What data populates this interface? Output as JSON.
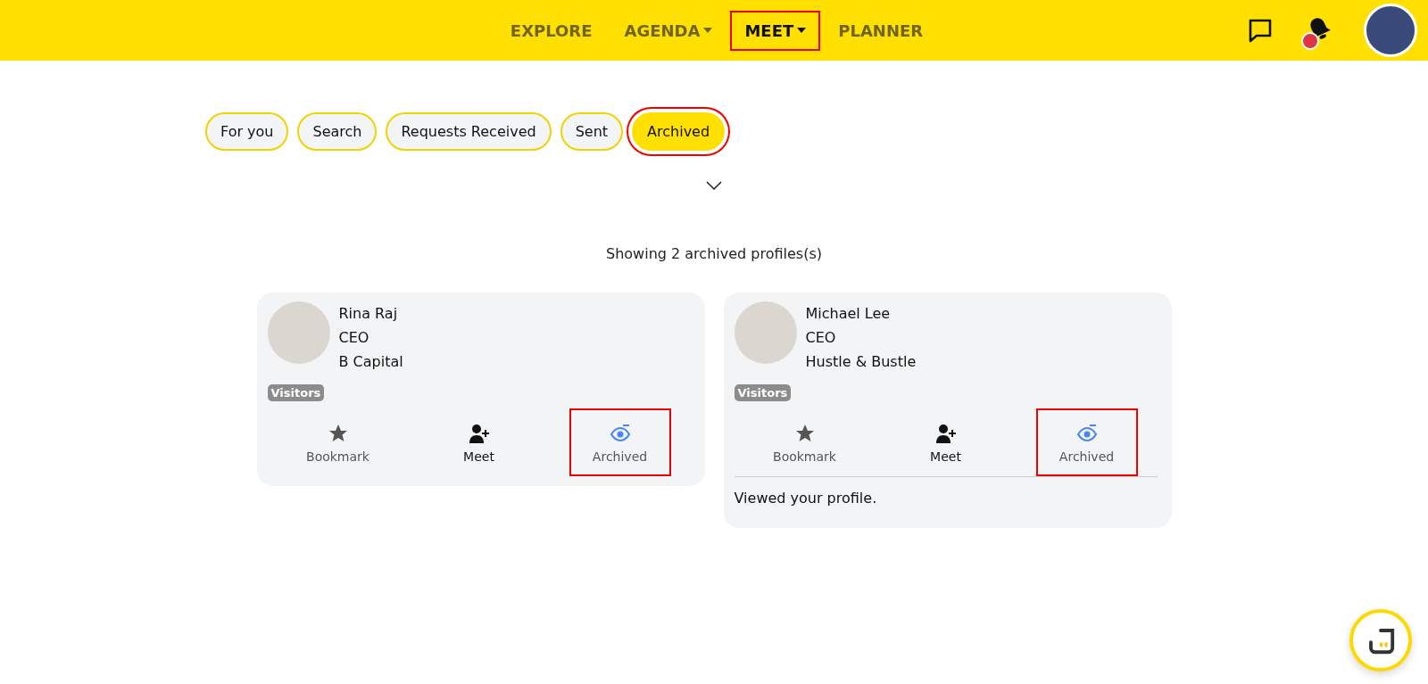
{
  "nav": {
    "items": [
      {
        "label": "EXPLORE",
        "dropdown": false,
        "selected": false,
        "highlighted": false
      },
      {
        "label": "AGENDA",
        "dropdown": true,
        "selected": false,
        "highlighted": false
      },
      {
        "label": "MEET",
        "dropdown": true,
        "selected": true,
        "highlighted": true
      },
      {
        "label": "PLANNER",
        "dropdown": false,
        "selected": false,
        "highlighted": false
      }
    ],
    "notification_dot": true
  },
  "tabs": [
    {
      "label": "For you",
      "selected": false,
      "highlighted": false
    },
    {
      "label": "Search",
      "selected": false,
      "highlighted": false
    },
    {
      "label": "Requests Received",
      "selected": false,
      "highlighted": false
    },
    {
      "label": "Sent",
      "selected": false,
      "highlighted": false
    },
    {
      "label": "Archived",
      "selected": true,
      "highlighted": true
    }
  ],
  "summary": "Showing 2 archived profiles(s)",
  "profiles": [
    {
      "name": "Rina Raj",
      "title": "CEO",
      "company": "B Capital",
      "tag": "Visitors",
      "actions": [
        {
          "kind": "bookmark",
          "label": "Bookmark",
          "highlighted": false
        },
        {
          "kind": "meet",
          "label": "Meet",
          "highlighted": false
        },
        {
          "kind": "archive",
          "label": "Archived",
          "highlighted": true
        }
      ]
    },
    {
      "name": "Michael Lee",
      "title": "CEO",
      "company": "Hustle & Bustle",
      "tag": "Visitors",
      "actions": [
        {
          "kind": "bookmark",
          "label": "Bookmark",
          "highlighted": false
        },
        {
          "kind": "meet",
          "label": "Meet",
          "highlighted": false
        },
        {
          "kind": "archive",
          "label": "Archived",
          "highlighted": true
        }
      ],
      "note": "Viewed your profile."
    }
  ]
}
